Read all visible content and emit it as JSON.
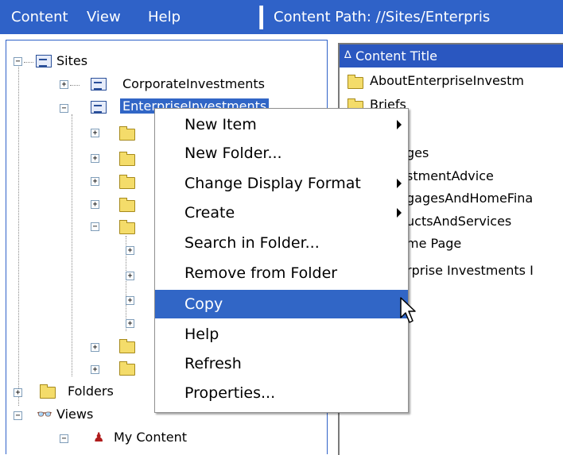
{
  "menubar": {
    "items": [
      "Content",
      "View",
      "Help"
    ],
    "content_path_label": "Content Path:",
    "content_path_value": "//Sites/Enterpris"
  },
  "tree": {
    "sites_label": "Sites",
    "corporate_label": "CorporateInvestments",
    "enterprise_label": "EnterpriseInvestments",
    "folders_label": "Folders",
    "views_label": "Views",
    "my_content_label": "My Content"
  },
  "content_list": {
    "column_header": "Content Title",
    "sort_indicator": "∆",
    "rows": [
      "AboutEnterpriseInvestm",
      "Briefs",
      "",
      "ges",
      "stmentAdvice",
      "gagesAndHomeFina",
      "uctsAndServices",
      "me Page",
      "rprise Investments I"
    ]
  },
  "context_menu": {
    "items": [
      {
        "label": "New Item",
        "submenu": true
      },
      {
        "label": "New Folder...",
        "submenu": false
      },
      {
        "label": "Change Display Format",
        "submenu": true
      },
      {
        "label": "Create",
        "submenu": true
      },
      {
        "label": "Search in Folder...",
        "submenu": false
      },
      {
        "label": "Remove from Folder",
        "submenu": false
      },
      {
        "label": "Copy",
        "submenu": false
      },
      {
        "label": "Help",
        "submenu": false
      },
      {
        "label": "Refresh",
        "submenu": false
      },
      {
        "label": "Properties...",
        "submenu": false
      }
    ],
    "highlighted_index": 6
  },
  "colors": {
    "accent": "#2f62c8",
    "highlight": "#3166c6",
    "folder": "#f4dc6a"
  },
  "icons": [
    "site-icon",
    "folder-icon",
    "folders-icon",
    "binoculars-icon",
    "user-icon",
    "expand-icon",
    "collapse-icon",
    "submenu-arrow-icon",
    "pointer-cursor-icon"
  ]
}
